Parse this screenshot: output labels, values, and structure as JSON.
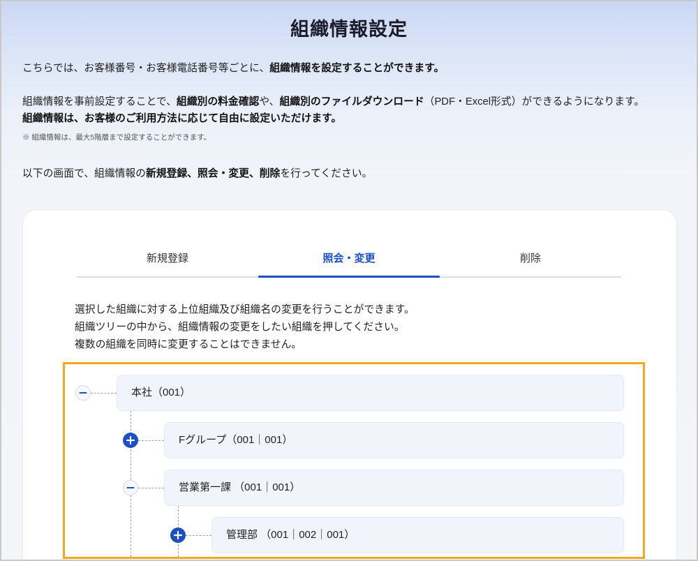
{
  "page": {
    "title": "組織情報設定"
  },
  "intro": {
    "p1": [
      "こちらでは、お客様番号・お客様電話番号等ごとに、",
      "組織情報を設定することができます。"
    ],
    "p2_line1": [
      "組織情報を事前設定することで、",
      "組織別の料金確認",
      "や、",
      "組織別のファイルダウンロード",
      "（PDF・Excel形式）ができるようになります。"
    ],
    "p2_line2": "組織情報は、お客様のご利用方法に応じて自由に設定いただけます。",
    "note": "※ 組織情報は、最大5階層まで設定することができます。",
    "p3": [
      "以下の画面で、組織情報の",
      "新規登録、照会・変更、削除",
      "を行ってください。"
    ]
  },
  "tabs": {
    "active_index": 1,
    "items": [
      {
        "label": "新規登録"
      },
      {
        "label": "照会・変更"
      },
      {
        "label": "削除"
      }
    ]
  },
  "panel": {
    "description": [
      "選択した組織に対する上位組織及び組織名の変更を行うことができます。",
      "組織ツリーの中から、組織情報の変更をしたい組織を押してください。",
      "複数の組織を同時に変更することはできません。"
    ]
  },
  "tree": {
    "nodes": [
      {
        "label": "本社（001）",
        "level": 0,
        "toggle_icon": "minus-icon"
      },
      {
        "label": "Fグループ（001｜001）",
        "level": 1,
        "toggle_icon": "plus-icon"
      },
      {
        "label": "営業第一課 （001｜001）",
        "level": 1,
        "toggle_icon": "minus-icon"
      },
      {
        "label": "管理部 （001｜002｜001）",
        "level": 2,
        "toggle_icon": "plus-icon"
      }
    ]
  },
  "colors": {
    "accent": "#1b4fc4",
    "highlight_frame": "#f2a81d",
    "node_background": "#f1f4fb"
  }
}
